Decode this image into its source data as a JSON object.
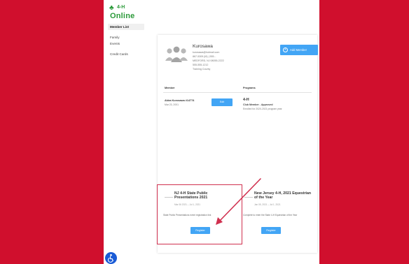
{
  "brand": {
    "name": "Online",
    "top": "4-H"
  },
  "sidebar": {
    "items": [
      {
        "label": "Member List",
        "active": true
      },
      {
        "label": "Family",
        "active": false
      },
      {
        "label": "Events",
        "active": false
      },
      {
        "label": "Credit Cards",
        "active": false
      }
    ]
  },
  "family": {
    "name": "Kurosawa",
    "lines": [
      "kurosawa@hotmail.com",
      "867-5309 (M) | 555...",
      "MEDFORD, NJ 08055-2222",
      "555-555-1212",
      "Training County"
    ],
    "add_member_label": "Add Member"
  },
  "columns": {
    "member": "Member",
    "programs": "Programs"
  },
  "member": {
    "name": "Akira Kurosawa #14774",
    "dob": "Mar 23, 2001",
    "edit_label": "Edit"
  },
  "program": {
    "name": "4-H",
    "role": "Club Member - Approved",
    "note": "Enrolled for 2020-2021 program year"
  },
  "events": [
    {
      "title": "NJ 4-H State Public Presentations 2021",
      "date": "Mar 06 2021 – Jul 1, 2021",
      "desc": "State Public Presentations event registration link",
      "register_label": "Register"
    },
    {
      "title": "New Jersey 4-H, 2021 Equestrian of the Year",
      "date": "Jan 05, 2021 – Jul 1, 2021",
      "desc": "Complete to enter the State 4-H Equestrian of the Year",
      "register_label": "Register"
    }
  ],
  "colors": {
    "side_band": "#d00f2d",
    "button": "#42a5f5",
    "annotation": "#d0304f",
    "accessibility": "#1a5bd6",
    "brand": "#2c9a3a"
  },
  "icons": {
    "family": "family-icon",
    "add": "plus-circle-icon",
    "event": "event-icon",
    "accessibility": "accessibility-icon",
    "arrow": "annotation-arrow"
  }
}
